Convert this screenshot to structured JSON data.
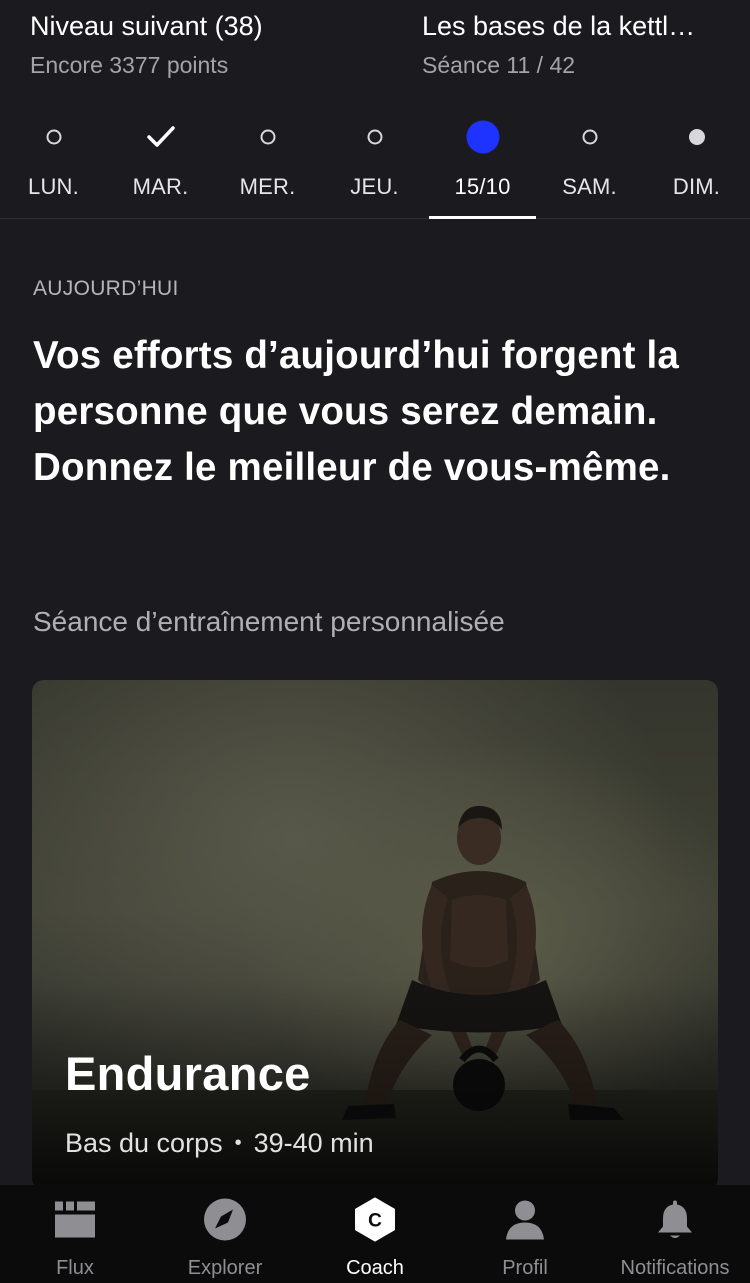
{
  "header": {
    "left": {
      "title": "Niveau suivant (38)",
      "subtitle": "Encore 3377 points"
    },
    "right": {
      "title": "Les bases de la kettl…",
      "subtitle": "Séance 11 / 42"
    }
  },
  "days": [
    {
      "label": "LUN.",
      "state": "empty"
    },
    {
      "label": "MAR.",
      "state": "completed"
    },
    {
      "label": "MER.",
      "state": "empty"
    },
    {
      "label": "JEU.",
      "state": "empty"
    },
    {
      "label": "15/10",
      "state": "current"
    },
    {
      "label": "SAM.",
      "state": "empty"
    },
    {
      "label": "DIM.",
      "state": "filled"
    }
  ],
  "today": {
    "section_label": "AUJOURD’HUI",
    "quote": "Vos efforts d’aujourd’hui forgent la personne que vous serez demain. Donnez le meilleur de vous-même.",
    "workout_section": "Séance d’entraînement personnalisée"
  },
  "workout_card": {
    "title": "Endurance",
    "focus": "Bas du corps",
    "separator": "•",
    "duration": "39-40 min"
  },
  "tabbar": {
    "items": [
      {
        "label": "Flux",
        "icon": "feed-icon"
      },
      {
        "label": "Explorer",
        "icon": "compass-icon"
      },
      {
        "label": "Coach",
        "icon": "coach-icon",
        "active": true
      },
      {
        "label": "Profil",
        "icon": "profile-icon"
      },
      {
        "label": "Notifications",
        "icon": "bell-icon"
      }
    ]
  },
  "colors": {
    "background": "#1b1b1f",
    "accent_current_day": "#1e33ff",
    "tabbar_background": "#0b0b0c"
  }
}
